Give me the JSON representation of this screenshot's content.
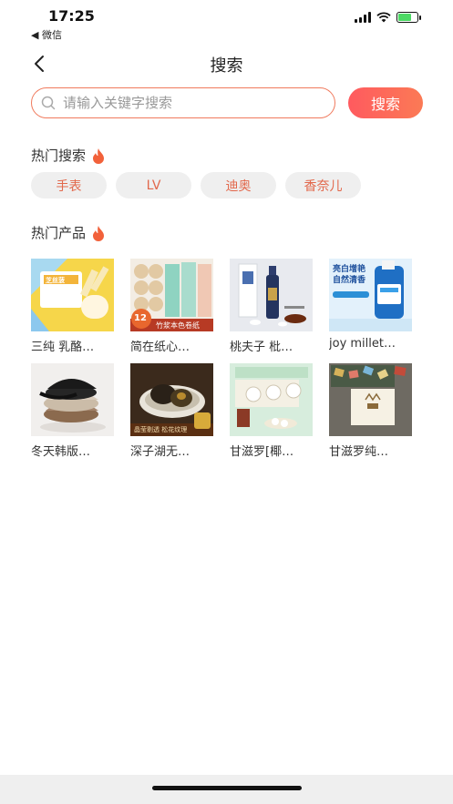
{
  "status_bar": {
    "time": "17:25",
    "back_app": "◀ 微信"
  },
  "nav": {
    "title": "搜索"
  },
  "search": {
    "placeholder": "请输入关键字搜索",
    "value": "",
    "button_label": "搜索"
  },
  "hot_search": {
    "title": "热门搜索",
    "tags": [
      "手表",
      "LV",
      "迪奥",
      "香奈儿"
    ]
  },
  "hot_products": {
    "title": "热门产品",
    "items": [
      {
        "name": "三纯 乳酪…",
        "overlay_texts": [
          "芝丝菠"
        ]
      },
      {
        "name": "简在纸心…",
        "overlay_texts": [
          "12",
          "竹浆本色卷纸"
        ]
      },
      {
        "name": "桃夫子 枇…",
        "overlay_texts": []
      },
      {
        "name": "joy millet…",
        "overlay_texts": [
          "亮白增艳",
          "自然清香"
        ]
      },
      {
        "name": "冬天韩版…",
        "overlay_texts": []
      },
      {
        "name": "深子湖无…",
        "overlay_texts": [
          "晶莹剔透 松花纹理"
        ]
      },
      {
        "name": "甘滋罗[椰…",
        "overlay_texts": []
      },
      {
        "name": "甘滋罗纯…",
        "overlay_texts": []
      }
    ]
  },
  "colors": {
    "accent": "#f07a5d",
    "tag_text": "#e2684c",
    "tag_bg": "#efefef"
  },
  "icons": {
    "back": "chevron-left-icon",
    "search": "search-icon",
    "flame": "flame-icon"
  }
}
